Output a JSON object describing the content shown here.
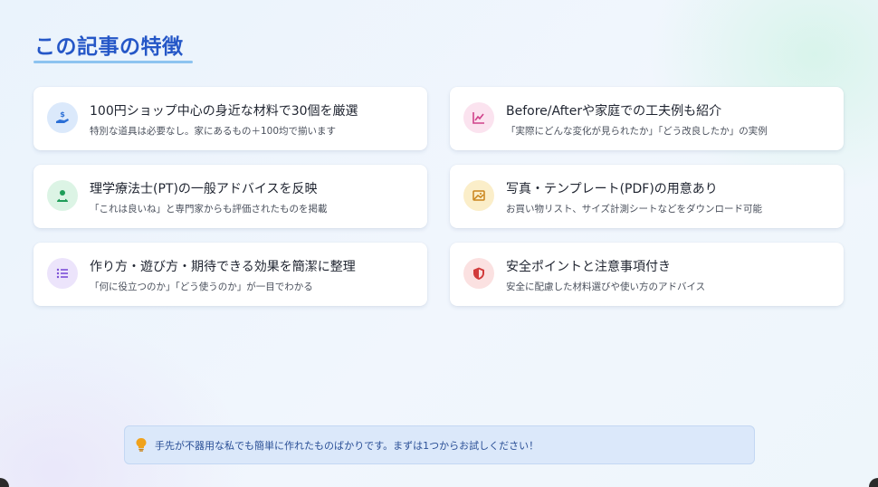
{
  "title": "この記事の特徴",
  "features": [
    {
      "icon": "hand-coin-icon",
      "color": "#2b6fd6",
      "bg": "#dbe9fb",
      "title": "100円ショップ中心の身近な材料で30個を厳選",
      "desc": "特別な道具は必要なし。家にあるもの＋100均で揃います"
    },
    {
      "icon": "chart-line-icon",
      "color": "#d0428a",
      "bg": "#fbe3ef",
      "title": "Before/Afterや家庭での工夫例も紹介",
      "desc": "「実際にどんな変化が見られたか」「どう改良したか」の実例"
    },
    {
      "icon": "therapist-icon",
      "color": "#1f9d59",
      "bg": "#dcf4e5",
      "title": "理学療法士(PT)の一般アドバイスを反映",
      "desc": "「これは良いね」と専門家からも評価されたものを掲載"
    },
    {
      "icon": "image-icon",
      "color": "#c9841a",
      "bg": "#fbeec9",
      "title": "写真・テンプレート(PDF)の用意あり",
      "desc": "お買い物リスト、サイズ計測シートなどをダウンロード可能"
    },
    {
      "icon": "list-icon",
      "color": "#7b4fd6",
      "bg": "#ece4fb",
      "title": "作り方・遊び方・期待できる効果を簡潔に整理",
      "desc": "「何に役立つのか」「どう使うのか」が一目でわかる"
    },
    {
      "icon": "shield-icon",
      "color": "#d13b3b",
      "bg": "#fbe1e1",
      "title": "安全ポイントと注意事項付き",
      "desc": "安全に配慮した材料選びや使い方のアドバイス"
    }
  ],
  "tip": {
    "icon": "lightbulb-icon",
    "color": "#f0a21b",
    "text": "手先が不器用な私でも簡単に作れたものばかりです。まずは1つからお試しください！"
  }
}
